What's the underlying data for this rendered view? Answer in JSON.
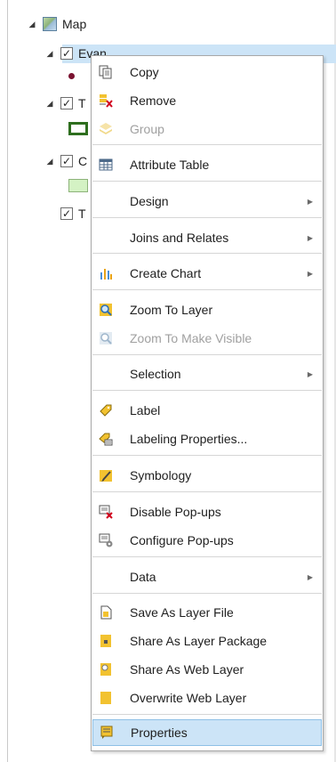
{
  "tree": {
    "root_label": "Map",
    "layer1_label": "Evan",
    "layer2_label": "T",
    "layer3_label": "C",
    "layer4_label": "T"
  },
  "menu": {
    "copy": "Copy",
    "remove": "Remove",
    "group": "Group",
    "attribute_table": "Attribute Table",
    "design": "Design",
    "joins_relates": "Joins and Relates",
    "create_chart": "Create Chart",
    "zoom_to_layer": "Zoom To Layer",
    "zoom_to_make_visible": "Zoom To Make Visible",
    "selection": "Selection",
    "label": "Label",
    "labeling_properties": "Labeling Properties...",
    "symbology": "Symbology",
    "disable_popups": "Disable Pop-ups",
    "configure_popups": "Configure Pop-ups",
    "data": "Data",
    "save_as_layer_file": "Save As Layer File",
    "share_as_layer_package": "Share As Layer Package",
    "share_as_web_layer": "Share As Web Layer",
    "overwrite_web_layer": "Overwrite Web Layer",
    "properties": "Properties"
  },
  "glyphs": {
    "expand": "◢",
    "check": "✓",
    "submenu": "▶"
  },
  "colors": {
    "highlight": "#cce4f7",
    "highlight_border": "#8ec0e6",
    "disabled_text": "#a0a0a0"
  }
}
